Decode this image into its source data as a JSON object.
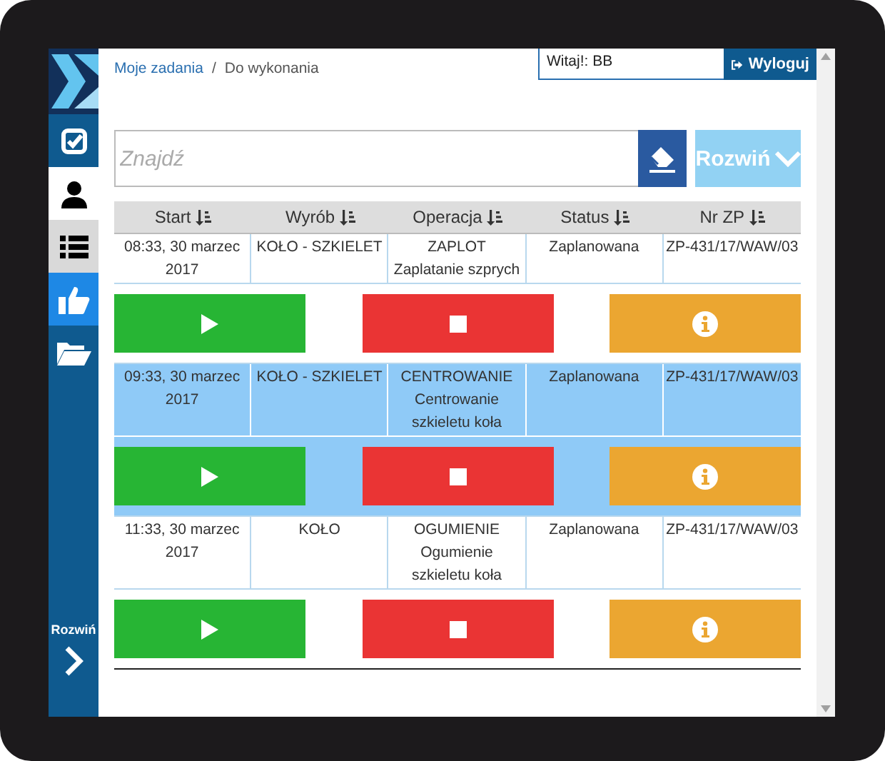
{
  "sidebar": {
    "items": [
      {
        "kind": "tasks",
        "selected": false,
        "color": "#0f5a8f"
      },
      {
        "kind": "user",
        "selected": true
      },
      {
        "kind": "list",
        "selected": false,
        "color": "#d9d9d9"
      },
      {
        "kind": "like",
        "selected": false,
        "color": "#1e88e5"
      },
      {
        "kind": "folder",
        "selected": false,
        "color": "#0f5a8f"
      }
    ],
    "expand_label": "Rozwiń"
  },
  "breadcrumb": {
    "link": "Moje zadania",
    "separator": "/",
    "current": "Do wykonania"
  },
  "user_field": {
    "value": "Witaj!: BB"
  },
  "logout_button": "Wyloguj",
  "search": {
    "placeholder": "Znajdź"
  },
  "expand_button": {
    "label": "Rozwiń",
    "disabled": true
  },
  "table": {
    "columns": [
      "Start",
      "Wyrób",
      "Operacja",
      "Status",
      "Nr ZP"
    ],
    "rows": [
      {
        "selected": false,
        "start": "08:33, 30 marzec 2017",
        "product": "KOŁO - SZKIELET",
        "operation": "ZAPLOT",
        "operation_detail": "Zaplatanie szprych",
        "status": "Zaplanowana",
        "order": "ZP-431/17/WAW/03",
        "actions": [
          {
            "kind": "start"
          },
          {
            "kind": "stop"
          },
          {
            "kind": "info"
          }
        ]
      },
      {
        "selected": true,
        "start": "09:33, 30 marzec 2017",
        "product": "KOŁO - SZKIELET",
        "operation": "CENTROWANIE",
        "operation_detail": "Centrowanie szkieletu koła",
        "status": "Zaplanowana",
        "order": "ZP-431/17/WAW/03",
        "actions": [
          {
            "kind": "start"
          },
          {
            "kind": "stop"
          },
          {
            "kind": "info"
          }
        ]
      },
      {
        "selected": false,
        "start": "11:33, 30 marzec 2017",
        "product": "KOŁO",
        "operation": "OGUMIENIE",
        "operation_detail": "Ogumienie szkieletu koła",
        "status": "Zaplanowana",
        "order": "ZP-431/17/WAW/03",
        "actions": [
          {
            "kind": "start"
          },
          {
            "kind": "stop"
          },
          {
            "kind": "info"
          }
        ]
      }
    ]
  }
}
